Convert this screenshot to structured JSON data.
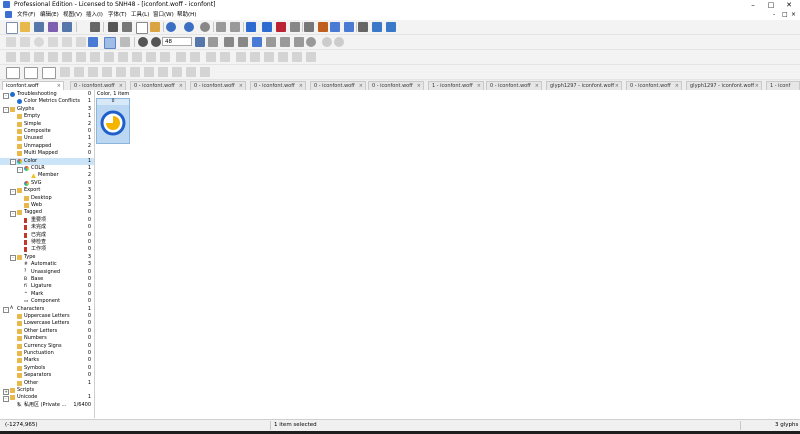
{
  "window": {
    "title": "Professional Edition - Licensed to SNH48 - [iconfont.woff - iconfont]",
    "controls": [
      "–",
      "□",
      "✕"
    ],
    "mdi_controls": [
      "-",
      "□",
      "×"
    ]
  },
  "menu": [
    "文件(F)",
    "编辑(E)",
    "视图(V)",
    "插入(I)",
    "字体(T)",
    "工具(L)",
    "窗口(W)",
    "帮助(H)"
  ],
  "toolbar": {
    "zoom_value": "48"
  },
  "tabs": [
    {
      "label": "iconfont.woff",
      "active": true
    },
    {
      "label": "0 - iconfont.woff",
      "active": false
    },
    {
      "label": "0 - iconfont.woff",
      "active": false
    },
    {
      "label": "0 - iconfont.woff",
      "active": false
    },
    {
      "label": "0 - iconfont.woff",
      "active": false
    },
    {
      "label": "0 - iconfont.woff",
      "active": false
    },
    {
      "label": "0 - iconfont.woff",
      "active": false
    },
    {
      "label": "1 - iconfont.woff",
      "active": false
    },
    {
      "label": "0 - iconfont.woff",
      "active": false
    },
    {
      "label": "glyph1297 - iconfont.woff",
      "active": false
    },
    {
      "label": "0 - iconfont.woff",
      "active": false
    },
    {
      "label": "glyph1297 - iconfont.woff",
      "active": false
    },
    {
      "label": "1 - iconf",
      "active": false
    }
  ],
  "tree": [
    {
      "label": "Troubleshooting",
      "count": "0",
      "level": 0,
      "icon": "info",
      "exp": "-"
    },
    {
      "label": "Color Metrics Conflicts",
      "count": "1",
      "level": 1,
      "icon": "info",
      "exp": ""
    },
    {
      "label": "Glyphs",
      "count": "3",
      "level": 0,
      "icon": "folder",
      "exp": "-"
    },
    {
      "label": "Empty",
      "count": "1",
      "level": 1,
      "icon": "folder",
      "exp": ""
    },
    {
      "label": "Simple",
      "count": "2",
      "level": 1,
      "icon": "folder",
      "exp": ""
    },
    {
      "label": "Composite",
      "count": "0",
      "level": 1,
      "icon": "folder",
      "exp": ""
    },
    {
      "label": "Unused",
      "count": "1",
      "level": 1,
      "icon": "folder",
      "exp": ""
    },
    {
      "label": "Unmapped",
      "count": "2",
      "level": 1,
      "icon": "folder",
      "exp": ""
    },
    {
      "label": "Multi Mapped",
      "count": "0",
      "level": 1,
      "icon": "folder",
      "exp": ""
    },
    {
      "label": "Color",
      "count": "1",
      "level": 1,
      "icon": "color",
      "exp": "-",
      "selected": true
    },
    {
      "label": "COLR",
      "count": "1",
      "level": 2,
      "icon": "color",
      "exp": "-"
    },
    {
      "label": "Member",
      "count": "2",
      "level": 3,
      "icon": "warn",
      "exp": ""
    },
    {
      "label": "SVG",
      "count": "0",
      "level": 2,
      "icon": "color",
      "exp": ""
    },
    {
      "label": "Export",
      "count": "3",
      "level": 1,
      "icon": "folder",
      "exp": "-"
    },
    {
      "label": "Desktop",
      "count": "3",
      "level": 2,
      "icon": "folder",
      "exp": ""
    },
    {
      "label": "Web",
      "count": "3",
      "level": 2,
      "icon": "folder",
      "exp": ""
    },
    {
      "label": "Tagged",
      "count": "0",
      "level": 1,
      "icon": "folder",
      "exp": "-"
    },
    {
      "label": "重要项",
      "count": "0",
      "level": 2,
      "icon": "flag",
      "exp": ""
    },
    {
      "label": "未完成",
      "count": "0",
      "level": 2,
      "icon": "flag",
      "exp": ""
    },
    {
      "label": "已完成",
      "count": "0",
      "level": 2,
      "icon": "flag",
      "exp": ""
    },
    {
      "label": "待检查",
      "count": "0",
      "level": 2,
      "icon": "flag",
      "exp": ""
    },
    {
      "label": "工作项",
      "count": "0",
      "level": 2,
      "icon": "flag",
      "exp": ""
    },
    {
      "label": "Type",
      "count": "3",
      "level": 1,
      "icon": "folder",
      "exp": "-"
    },
    {
      "label": "Automatic",
      "count": "3",
      "level": 2,
      "icon": "glyph",
      "exp": "",
      "glyph": "#"
    },
    {
      "label": "Unassigned",
      "count": "0",
      "level": 2,
      "icon": "glyph",
      "exp": "",
      "glyph": "?"
    },
    {
      "label": "Base",
      "count": "0",
      "level": 2,
      "icon": "glyph",
      "exp": "",
      "glyph": "B"
    },
    {
      "label": "Ligature",
      "count": "0",
      "level": 2,
      "icon": "glyph",
      "exp": "",
      "glyph": "fi"
    },
    {
      "label": "Mark",
      "count": "0",
      "level": 2,
      "icon": "glyph",
      "exp": "",
      "glyph": "^"
    },
    {
      "label": "Component",
      "count": "0",
      "level": 2,
      "icon": "glyph",
      "exp": "",
      "glyph": "▭"
    },
    {
      "label": "Characters",
      "count": "1",
      "level": 0,
      "icon": "glyph",
      "exp": "-",
      "glyph": "A"
    },
    {
      "label": "Uppercase Letters",
      "count": "0",
      "level": 1,
      "icon": "folder",
      "exp": ""
    },
    {
      "label": "Lowercase Letters",
      "count": "0",
      "level": 1,
      "icon": "folder",
      "exp": ""
    },
    {
      "label": "Other Letters",
      "count": "0",
      "level": 1,
      "icon": "folder",
      "exp": ""
    },
    {
      "label": "Numbers",
      "count": "0",
      "level": 1,
      "icon": "folder",
      "exp": ""
    },
    {
      "label": "Currency Signs",
      "count": "0",
      "level": 1,
      "icon": "folder",
      "exp": ""
    },
    {
      "label": "Punctuation",
      "count": "0",
      "level": 1,
      "icon": "folder",
      "exp": ""
    },
    {
      "label": "Marks",
      "count": "0",
      "level": 1,
      "icon": "folder",
      "exp": ""
    },
    {
      "label": "Symbols",
      "count": "0",
      "level": 1,
      "icon": "folder",
      "exp": ""
    },
    {
      "label": "Separators",
      "count": "0",
      "level": 1,
      "icon": "folder",
      "exp": ""
    },
    {
      "label": "Other",
      "count": "1",
      "level": 1,
      "icon": "folder",
      "exp": ""
    },
    {
      "label": "Scripts",
      "count": "",
      "level": 0,
      "icon": "folder",
      "exp": "+"
    },
    {
      "label": "Unicode",
      "count": "1",
      "level": 0,
      "icon": "folder",
      "exp": "-"
    },
    {
      "label": "私用区 (Private ...",
      "count": "1/6400",
      "level": 1,
      "icon": "glyph",
      "exp": "",
      "glyph": "私"
    }
  ],
  "panel": {
    "header": "Color, 1 item",
    "glyph_label": "0",
    "glyph_colors": {
      "ring": "#1f5fcc",
      "fill": "#f4b400"
    }
  },
  "status": {
    "coords": "(-1274,965)",
    "selection": "1 item selected",
    "glyph_count": "3 glyphs"
  }
}
